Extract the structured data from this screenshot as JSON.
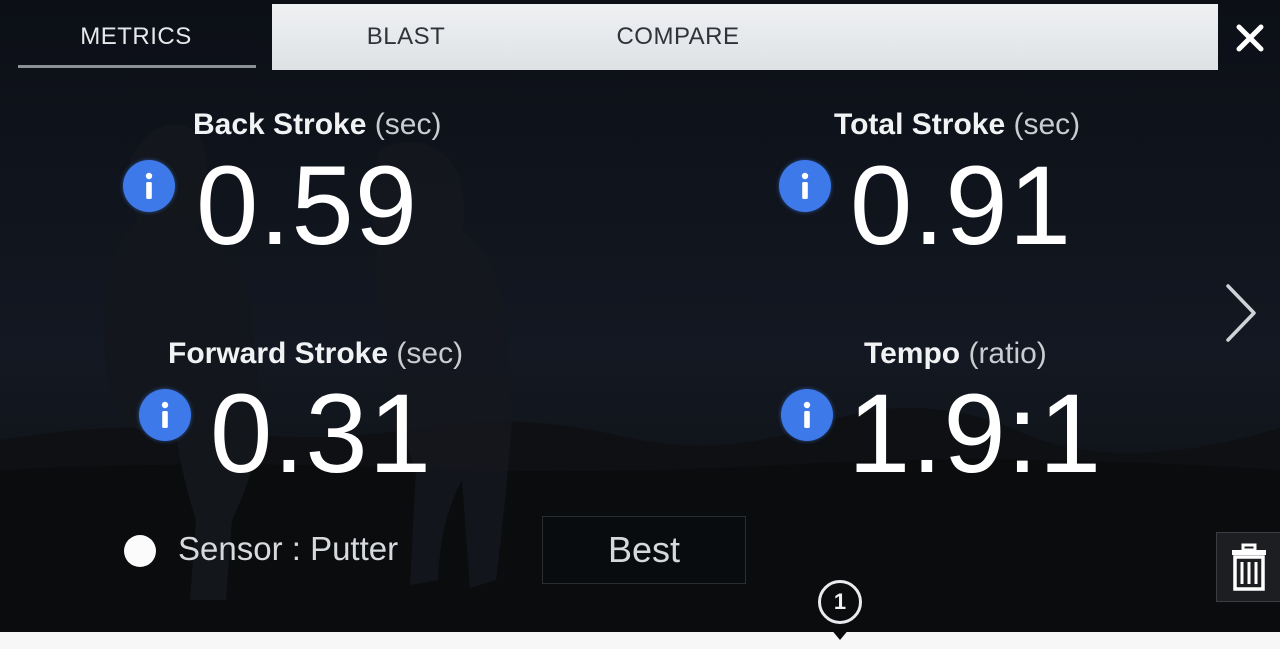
{
  "tabs": [
    {
      "label": "METRICS",
      "active": true
    },
    {
      "label": "BLAST",
      "active": false
    },
    {
      "label": "COMPARE",
      "active": false
    }
  ],
  "close_icon": "close-icon",
  "metrics": {
    "back_stroke": {
      "label": "Back Stroke",
      "unit": "(sec)",
      "value": "0.59"
    },
    "total_stroke": {
      "label": "Total Stroke",
      "unit": "(sec)",
      "value": "0.91"
    },
    "forward_stroke": {
      "label": "Forward Stroke",
      "unit": "(sec)",
      "value": "0.31"
    },
    "tempo": {
      "label": "Tempo",
      "unit": "(ratio)",
      "value": "1.9:1"
    }
  },
  "info_icon": "info-icon",
  "info_color": "#3d79e8",
  "next_icon": "chevron-right-icon",
  "sensor": {
    "text": "Sensor : Putter"
  },
  "best_button": {
    "label": "Best"
  },
  "trash_icon": "trash-icon",
  "page_indicator": {
    "number": "1"
  }
}
